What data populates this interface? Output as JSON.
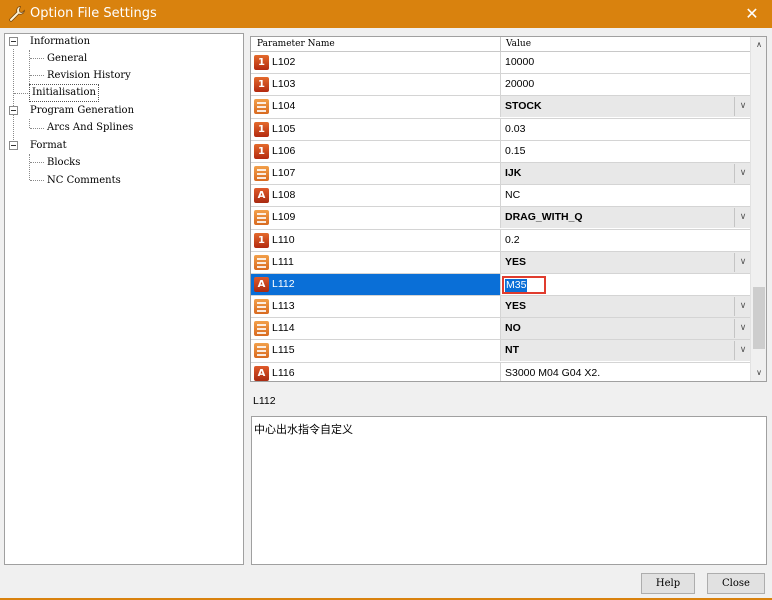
{
  "window": {
    "title": "Option File Settings",
    "close_glyph": "✕"
  },
  "tree": {
    "items": [
      {
        "label": "Information"
      },
      {
        "label": "General"
      },
      {
        "label": "Revision History"
      },
      {
        "label": "Initialisation"
      },
      {
        "label": "Program Generation"
      },
      {
        "label": "Arcs And Splines"
      },
      {
        "label": "Format"
      },
      {
        "label": "Blocks"
      },
      {
        "label": "NC Comments"
      }
    ]
  },
  "grid": {
    "header": {
      "name": "Parameter Name",
      "value": "Value"
    },
    "rows": [
      {
        "name": "L102",
        "value": "10000",
        "icon": "numeric-icon",
        "icon_text": "1"
      },
      {
        "name": "L103",
        "value": "20000",
        "icon": "numeric-icon",
        "icon_text": "1"
      },
      {
        "name": "L104",
        "value": "STOCK",
        "icon": "list-icon",
        "icon_text": ""
      },
      {
        "name": "L105",
        "value": "0.03",
        "icon": "numeric-icon",
        "icon_text": "1"
      },
      {
        "name": "L106",
        "value": "0.15",
        "icon": "numeric-icon",
        "icon_text": "1"
      },
      {
        "name": "L107",
        "value": "IJK",
        "icon": "list-icon",
        "icon_text": ""
      },
      {
        "name": "L108",
        "value": "NC",
        "icon": "text-icon",
        "icon_text": "A"
      },
      {
        "name": "L109",
        "value": "DRAG_WITH_Q",
        "icon": "list-icon",
        "icon_text": ""
      },
      {
        "name": "L110",
        "value": "0.2",
        "icon": "numeric-icon",
        "icon_text": "1"
      },
      {
        "name": "L111",
        "value": "YES",
        "icon": "list-icon",
        "icon_text": ""
      },
      {
        "name": "L112",
        "value": "M35",
        "icon": "text-icon",
        "icon_text": "A"
      },
      {
        "name": "L113",
        "value": "YES",
        "icon": "list-icon",
        "icon_text": ""
      },
      {
        "name": "L114",
        "value": "NO",
        "icon": "list-icon",
        "icon_text": ""
      },
      {
        "name": "L115",
        "value": "NT",
        "icon": "list-icon",
        "icon_text": ""
      },
      {
        "name": "L116",
        "value": "S3000 M04 G04 X2.",
        "icon": "text-icon",
        "icon_text": "A"
      }
    ],
    "dropdown_glyph": "∨",
    "scroll_up_glyph": "∧",
    "scroll_down_glyph": "∨"
  },
  "description": {
    "label": "L112",
    "text": "中心出水指令自定义"
  },
  "buttons": {
    "help": "Help",
    "close": "Close"
  },
  "colors": {
    "titlebar": "#d9820e",
    "selection": "#0a6fd7",
    "highlight_border": "#e03c2e"
  }
}
